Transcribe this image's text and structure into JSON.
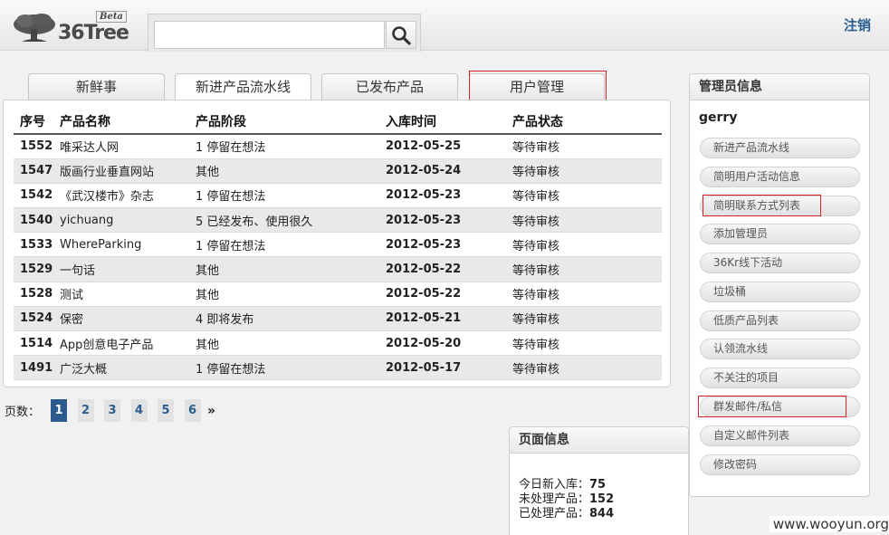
{
  "header": {
    "logo_text": "36Tree",
    "logo_badge": "Beta",
    "search": {
      "value": "",
      "placeholder": ""
    },
    "logout_label": "注销"
  },
  "tabs": [
    {
      "label": "新鲜事",
      "active": false
    },
    {
      "label": "新进产品流水线",
      "active": true
    },
    {
      "label": "已发布产品",
      "active": false
    },
    {
      "label": "用户管理",
      "active": false
    }
  ],
  "table": {
    "columns": [
      "序号",
      "产品名称",
      "产品阶段",
      "入库时间",
      "产品状态"
    ],
    "rows": [
      {
        "id": "1552",
        "name": "唯采达人网",
        "stage": "1 停留在想法",
        "date": "2012-05-25",
        "status": "等待审核"
      },
      {
        "id": "1547",
        "name": "版画行业垂直网站",
        "stage": "其他",
        "date": "2012-05-24",
        "status": "等待审核"
      },
      {
        "id": "1542",
        "name": "《武汉楼市》杂志",
        "stage": "1 停留在想法",
        "date": "2012-05-23",
        "status": "等待审核"
      },
      {
        "id": "1540",
        "name": "yichuang",
        "stage": "5 已经发布、使用很久",
        "date": "2012-05-23",
        "status": "等待审核"
      },
      {
        "id": "1533",
        "name": "WhereParking",
        "stage": "1 停留在想法",
        "date": "2012-05-23",
        "status": "等待审核"
      },
      {
        "id": "1529",
        "name": "一句话",
        "stage": "其他",
        "date": "2012-05-22",
        "status": "等待审核"
      },
      {
        "id": "1528",
        "name": "测试",
        "stage": "其他",
        "date": "2012-05-22",
        "status": "等待审核"
      },
      {
        "id": "1524",
        "name": "保密",
        "stage": "4 即将发布",
        "date": "2012-05-21",
        "status": "等待审核"
      },
      {
        "id": "1514",
        "name": "App创意电子产品",
        "stage": "其他",
        "date": "2012-05-20",
        "status": "等待审核"
      },
      {
        "id": "1491",
        "name": "广泛大概",
        "stage": "1 停留在想法",
        "date": "2012-05-17",
        "status": "等待审核"
      }
    ]
  },
  "pager": {
    "label": "页数：",
    "pages": [
      "1",
      "2",
      "3",
      "4",
      "5",
      "6"
    ],
    "current": "1",
    "next": "»"
  },
  "page_info": {
    "title": "页面信息",
    "lines": [
      {
        "label": "今日新入库：",
        "value": "75"
      },
      {
        "label": "未处理产品：",
        "value": "152"
      },
      {
        "label": "已处理产品：",
        "value": "844"
      }
    ]
  },
  "admin": {
    "title": "管理员信息",
    "username": "gerry",
    "items": [
      "新进产品流水线",
      "简明用户活动信息",
      "简明联系方式列表",
      "添加管理员",
      "36Kr线下活动",
      "垃圾桶",
      "低质产品列表",
      "认领流水线",
      "不关注的项目",
      "群发邮件/私信",
      "自定义邮件列表",
      "修改密码"
    ]
  },
  "watermark": "www.wooyun.org",
  "colors": {
    "link": "#2b5d8f",
    "pager_active": "#2d5a8c",
    "highlight_box": "#d32020"
  }
}
